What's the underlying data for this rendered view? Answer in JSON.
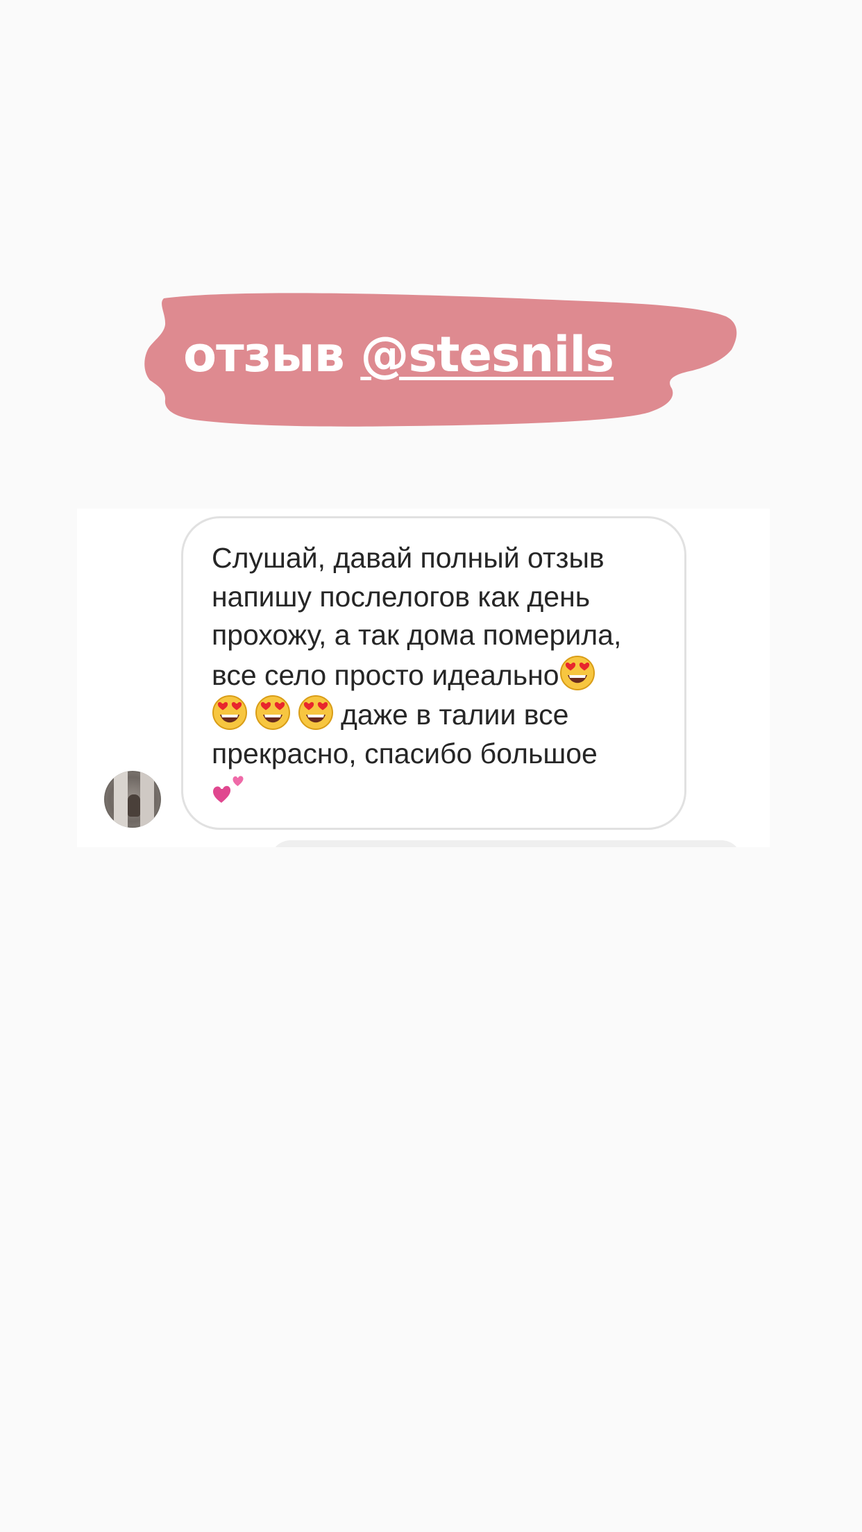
{
  "title_sticker": {
    "prefix": "отзыв ",
    "handle": "@stesnils",
    "brush_color": "#de8a90"
  },
  "dm": {
    "avatar_icon": "user-avatar-photo",
    "message": {
      "line1": "Слушай, давай полный отзыв",
      "line2": "напишу послелогов как день",
      "line3": "прохожу, а так дома померила,",
      "line4": "все село просто идеально",
      "line5": "даже в талии все",
      "line6": "прекрасно, спасибо большое",
      "emoji_icon": "smiling-face-with-heart-eyes-icon",
      "trailing_icon": "two-hearts-icon"
    }
  }
}
